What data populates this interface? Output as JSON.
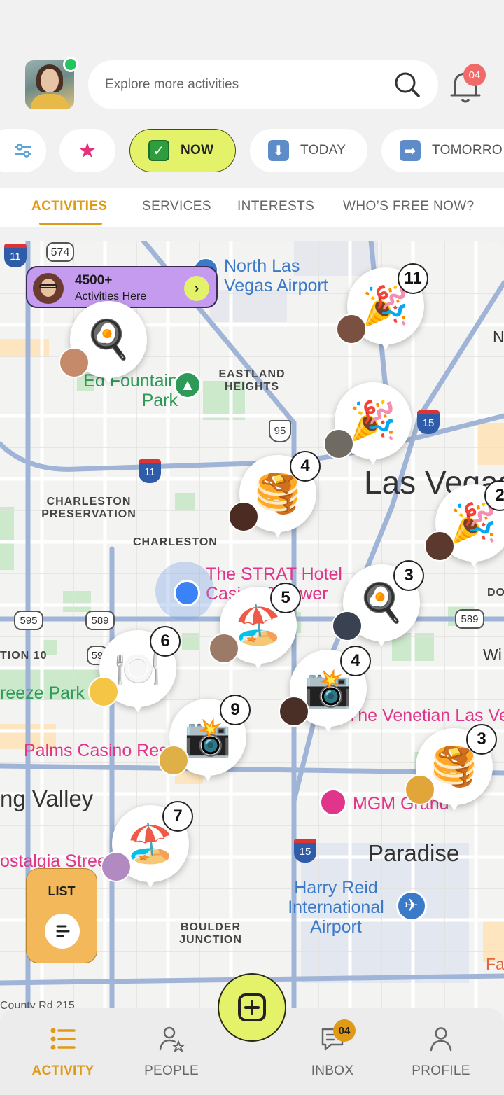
{
  "header": {
    "search_placeholder": "Explore more activities",
    "notification_count": "04"
  },
  "chips": {
    "now": "NOW",
    "today": "TODAY",
    "tomorrow": "TOMORRO"
  },
  "tabs": [
    "ACTIVITIES",
    "SERVICES",
    "INTERESTS",
    "WHO’S FREE NOW?"
  ],
  "map": {
    "cta_count": "4500+",
    "cta_text": "Activities Here",
    "labels": {
      "north_airport": "North Las Vegas Airport",
      "eastland": "EASTLAND HEIGHTS",
      "ed_fountain": "Ed Fountain Park",
      "charleston_pres": "CHARLESTON PRESERVATION",
      "charleston": "CHARLESTON",
      "las_vegas": "Las Vegas",
      "strat": "The STRAT Hotel Casino & Tower",
      "venetian": "The Venetian Las Vegas",
      "palms": "Palms Casino Resort",
      "spring_valley": "ng Valley",
      "paradise": "Paradise",
      "mgm": "MGM Grand",
      "harry_reid": "Harry Reid International Airport",
      "boulder": "BOULDER JUNCTION",
      "breeze_park": "reeze Park",
      "nostalgia": "ostalgia Street",
      "route10": "TION 10",
      "county_rd": "County Rd 215",
      "wi": "Wi",
      "do": "DO",
      "fa": "Fa",
      "n": "N"
    },
    "shields": {
      "s574": "574",
      "s11a": "11",
      "s11b": "11",
      "s15a": "15",
      "s15b": "15",
      "s95": "95",
      "s595": "595",
      "s589a": "589",
      "s589b": "589",
      "s59": "59"
    },
    "pins": [
      {
        "id": "pin-breakfast-1",
        "emoji": "🍳",
        "count": ""
      },
      {
        "id": "pin-party-1",
        "emoji": "🎉",
        "count": "11"
      },
      {
        "id": "pin-party-2",
        "emoji": "🎉",
        "count": ""
      },
      {
        "id": "pin-pancakes-1",
        "emoji": "🥞",
        "count": "4"
      },
      {
        "id": "pin-party-3",
        "emoji": "🎉",
        "count": "2"
      },
      {
        "id": "pin-breakfast-2",
        "emoji": "🍳",
        "count": "3"
      },
      {
        "id": "pin-beach-1",
        "emoji": "🏖️",
        "count": "5"
      },
      {
        "id": "pin-dining",
        "emoji": "🍽️",
        "count": "6"
      },
      {
        "id": "pin-camera-1",
        "emoji": "📸",
        "count": "4"
      },
      {
        "id": "pin-camera-2",
        "emoji": "📸",
        "count": "9"
      },
      {
        "id": "pin-pancakes-2",
        "emoji": "🥞",
        "count": "3"
      },
      {
        "id": "pin-beach-2",
        "emoji": "🏖️",
        "count": "7"
      }
    ],
    "list_button": "LIST"
  },
  "nav": {
    "activity": "ACTIVITY",
    "people": "PEOPLE",
    "inbox": "INBOX",
    "inbox_count": "04",
    "profile": "PROFILE"
  },
  "colors": {
    "accent": "#e09a17",
    "lime": "#e4f26a",
    "purple": "#c59bf0",
    "list": "#f2b85a"
  }
}
